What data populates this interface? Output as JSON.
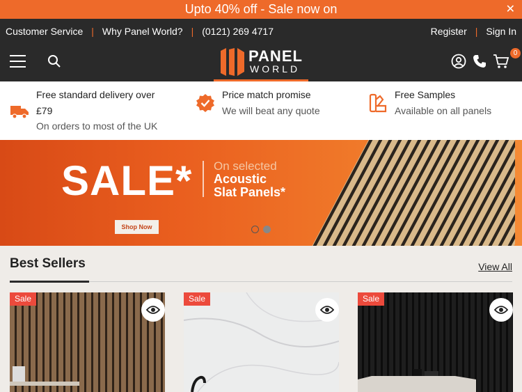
{
  "promo": {
    "text": "Upto 40% off - Sale now on",
    "close": "✕"
  },
  "topbar": {
    "links": [
      "Customer Service",
      "Why Panel World?",
      "(0121) 269 4717"
    ],
    "register": "Register",
    "signin": "Sign In",
    "separator": "|"
  },
  "logo": {
    "line1": "PANEL",
    "line2": "WORLD"
  },
  "cart": {
    "count": "0"
  },
  "usps": [
    {
      "title": "Free standard delivery over",
      "title2": "£79",
      "sub": "On orders to most of the UK",
      "icon": "truck-icon"
    },
    {
      "title": "Price match promise",
      "sub": "We will beat any quote",
      "icon": "badge-check-icon"
    },
    {
      "title": "Free Samples",
      "sub": "Available on all panels",
      "icon": "samples-icon"
    }
  ],
  "hero": {
    "headline": "SALE*",
    "line1": "On selected",
    "line2": "Acoustic",
    "line3": "Slat Panels*",
    "cta": "Shop Now"
  },
  "bestsellers": {
    "title": "Best Sellers",
    "view_all": "View All"
  },
  "products": [
    {
      "badge": "Sale"
    },
    {
      "badge": "Sale"
    },
    {
      "badge": "Sale"
    }
  ],
  "colors": {
    "brand_orange": "#ee6a2a",
    "dark": "#2a2a2a",
    "sale_red": "#ec4a3c"
  }
}
